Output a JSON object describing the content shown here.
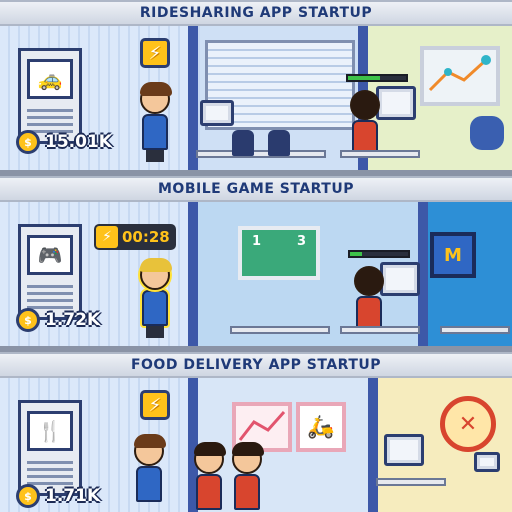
{
  "startups": [
    {
      "title": "RIDESHARING APP STARTUP",
      "cash": "15.01K",
      "rack_icon": "taxi-icon",
      "boost_icon": "lightning-bolt-icon",
      "progress": 0.55,
      "colors": {
        "accent": "#ffc21a",
        "floor": "#cfe0f5"
      }
    },
    {
      "title": "MOBILE GAME STARTUP",
      "cash": "1.72K",
      "rack_icon": "gamepad-icon",
      "boost_icon": "lightning-bolt-icon",
      "boost_timer": "00:28",
      "progress": 0.2,
      "scoreboard": {
        "left": "1",
        "right": "3"
      },
      "colors": {
        "accent": "#ffc21a",
        "floor": "#cfe0f5"
      }
    },
    {
      "title": "FOOD DELIVERY APP STARTUP",
      "cash": "1.71K",
      "rack_icon": "food-icon",
      "boost_icon": "lightning-bolt-icon",
      "colors": {
        "accent": "#ffc21a",
        "floor": "#f3e7c8"
      }
    }
  ]
}
